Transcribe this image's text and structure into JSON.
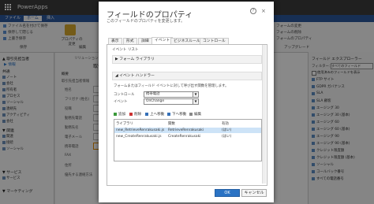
{
  "app": {
    "title": "PowerApps"
  },
  "ribbon": {
    "tabs": [
      "ファイル",
      "ホーム",
      "挿入"
    ],
    "small_buttons": [
      "ファイル名を付けて保存",
      "保存して閉じる",
      "上書き保存"
    ],
    "big_button": "プロパティの変更",
    "right_buttons": [
      "フォームの変更",
      "フォームの削除",
      "フォームのプロパティ"
    ],
    "groups": [
      "保存",
      "編集",
      "アップグレード"
    ]
  },
  "left_nav": {
    "heading": "▲ 取引先担当者",
    "subheading": "▶ 情報",
    "items": [
      "共通",
      "ノート",
      "会社",
      "所有者",
      "プロセス",
      "ソーシャル",
      "連絡先",
      "アクティビティ",
      "会社",
      "関連",
      "接続",
      "ソーシャル",
      "サービス"
    ],
    "section2": "▼ 関連",
    "section3": "▼ サービス",
    "section4": "▼ マーケティング"
  },
  "form_bg": {
    "header_label": "リリューション：既定のソリ",
    "tab_label": "取引",
    "section": "概要",
    "fields": [
      "取引先担当者情報",
      "姓名",
      "フリガナ (姓名)",
      "役職",
      "勤務先電話",
      "勤務先名",
      "電子メール",
      "携帯電話",
      "FAX",
      "住所",
      "優先する連絡方法"
    ]
  },
  "right_pane": {
    "header": "フィールド エクスプローラー",
    "filter_label": "フィルター：",
    "filter_value": "すべてのフィールド",
    "checkbox_label": "使用済みのフィールドを表示",
    "items": [
      "FTP サイト",
      "GDPR ガバナンス",
      "SLA",
      "SLA 顧客",
      "エージング 30",
      "エージング 30 (基本)",
      "エージング 60",
      "エージング 60 (基本)",
      "エージング 90",
      "エージング 90 (基本)",
      "クレジット限度額",
      "クレジット限度額 (基本)",
      "ソーシャル",
      "コールバック番号",
      "すべての電話番号"
    ]
  },
  "dialog": {
    "title": "フィールドのプロパティ",
    "subtitle": "このフィールドのプロパティを変更します。",
    "help": "?",
    "close": "×",
    "tabs": [
      "表示",
      "形式",
      "詳細",
      "イベント",
      "ビジネスルール",
      "コントロール"
    ],
    "selected_tab": "イベント",
    "event_list_label": "イベント リスト",
    "form_library_label": "▶ フォーム ライブラリ",
    "event_handler_label": "◢ イベント ハンドラー",
    "handler_desc": "フォームまたはフィールド イベントに対して呼び出す関数を管理します。",
    "control_label": "コントロール",
    "control_value": "携帯電話",
    "event_label": "イベント",
    "event_value": "OnChange",
    "toolbar": [
      "追加",
      "削除",
      "上へ移動",
      "下へ移動",
      "編集"
    ],
    "table_headers": [
      "ライブラリ",
      "関数",
      "有効"
    ],
    "rows": [
      {
        "library": "new_RetrieveRenrakusaki.js",
        "function": "RetrieveRenrakusaki",
        "enabled": "(はい)",
        "selected": true
      },
      {
        "library": "new_CreateRenrakusaki.js",
        "function": "CreateRenrakusaki",
        "enabled": "(はい)",
        "selected": false
      }
    ],
    "ok_label": "OK",
    "cancel_label": "キャンセル"
  }
}
